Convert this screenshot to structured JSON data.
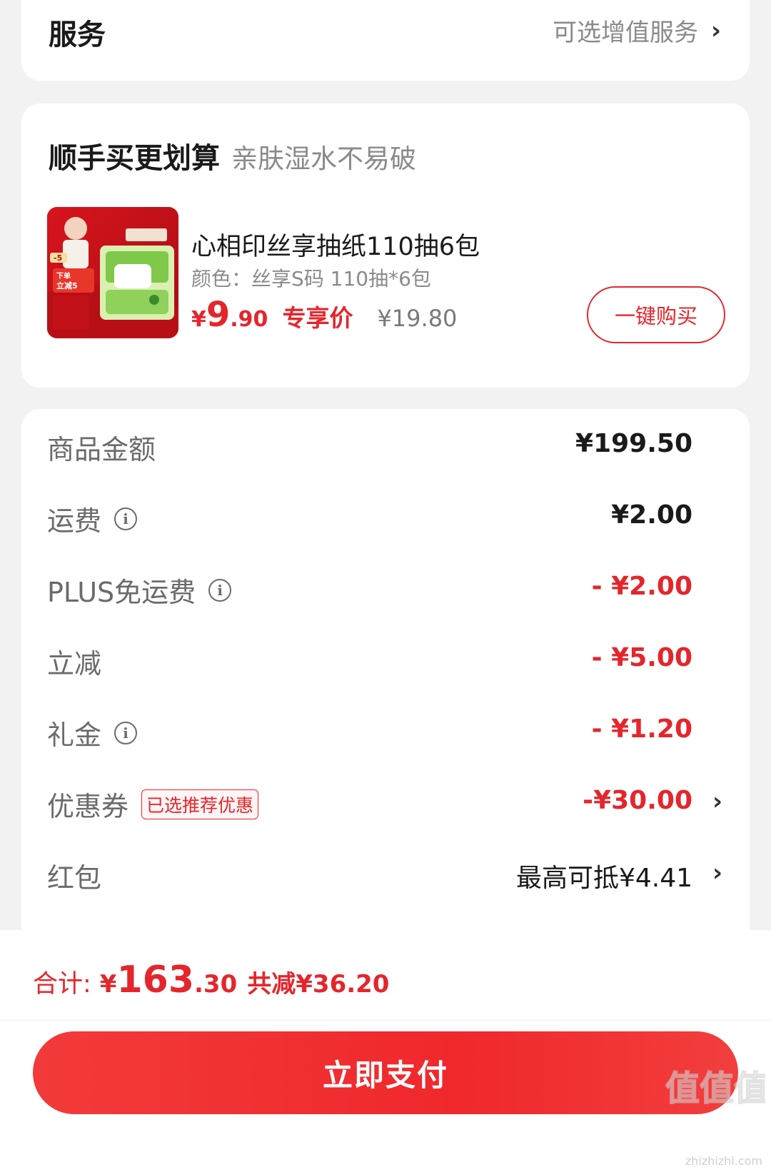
{
  "service": {
    "title": "服务",
    "right_text": "可选增值服务"
  },
  "addon": {
    "title": "顺手买更划算",
    "subtitle": "亲肤湿水不易破",
    "product": {
      "name": "心相印丝享抽纸110抽6包",
      "spec": "颜色：丝享S码 110抽*6包",
      "price_yen": "¥",
      "price_int": "9",
      "price_dec": ".90",
      "price_tag": "专享价",
      "original_price": "¥19.80",
      "buy_label": "一键购买",
      "thumb_badge": "下单立减5",
      "thumb_minus": "-5"
    }
  },
  "summary": {
    "rows": [
      {
        "label": "商品金额",
        "value": "¥199.50"
      },
      {
        "label": "运费",
        "value": "¥2.00"
      },
      {
        "label": "PLUS免运费",
        "value": "- ¥2.00"
      },
      {
        "label": "立减",
        "value": "- ¥5.00"
      },
      {
        "label": "礼金",
        "value": "- ¥1.20"
      },
      {
        "label": "优惠券",
        "badge": "已选推荐优惠",
        "value": "-¥30.00"
      },
      {
        "label": "红包",
        "value": "最高可抵¥4.41"
      }
    ]
  },
  "footer": {
    "total_label": "合计:",
    "total_yen": "¥",
    "total_int": "163",
    "total_dec": ".30",
    "total_saving": "共减¥36.20",
    "pay_label": "立即支付"
  },
  "watermark": {
    "logo_text": "值值值",
    "url": "zhizhizhi.com"
  },
  "colors": {
    "accent": "#e4262c",
    "background": "#f2f2f2",
    "muted": "#8a8a8a"
  },
  "icons": [
    "chevron-right-icon",
    "info-icon"
  ]
}
